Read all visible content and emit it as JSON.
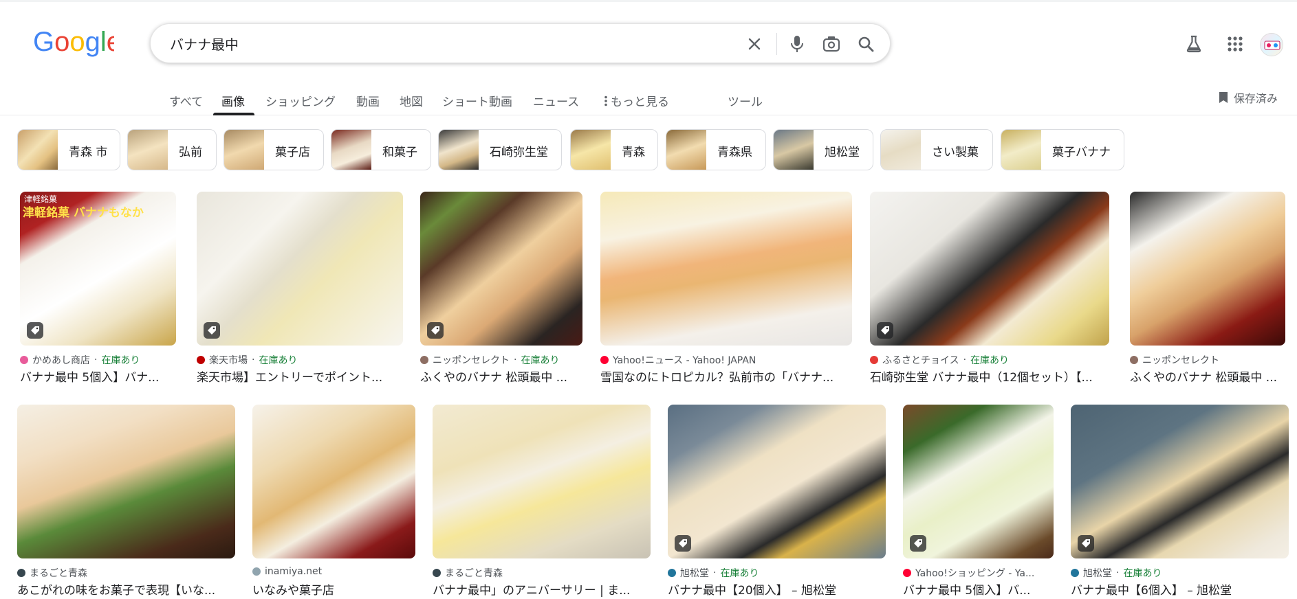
{
  "search": {
    "query": "バナナ最中"
  },
  "header": {
    "logo_text": "Google"
  },
  "tabs": [
    {
      "label": "すべて"
    },
    {
      "label": "画像"
    },
    {
      "label": "ショッピング"
    },
    {
      "label": "動画"
    },
    {
      "label": "地図"
    },
    {
      "label": "ショート動画"
    },
    {
      "label": "ニュース"
    },
    {
      "label": "もっと見る"
    },
    {
      "label": "ツール"
    }
  ],
  "active_tab": "画像",
  "saved_label": "保存済み",
  "chips": [
    {
      "label": "青森 市"
    },
    {
      "label": "弘前"
    },
    {
      "label": "菓子店"
    },
    {
      "label": "和菓子"
    },
    {
      "label": "石崎弥生堂"
    },
    {
      "label": "青森"
    },
    {
      "label": "青森県"
    },
    {
      "label": "旭松堂"
    },
    {
      "label": "さい製菓"
    },
    {
      "label": "菓子バナナ"
    }
  ],
  "results": [
    {
      "source": "かめあし商店",
      "stock": "在庫あり",
      "title": "バナナ最中 5個入】バナ...",
      "overlay": "津軽銘菓 バナナもなか"
    },
    {
      "source": "楽天市場",
      "stock": "在庫あり",
      "title": "楽天市場】エントリーでポイント..."
    },
    {
      "source": "ニッポンセレクト",
      "stock": "在庫あり",
      "title": "ふくやのバナナ 松頭最中 ..."
    },
    {
      "source": "Yahoo!ニュース - Yahoo! JAPAN",
      "stock": "",
      "title": "雪国なのにトロピカル？弘前市の「バナナ..."
    },
    {
      "source": "ふるさとチョイス",
      "stock": "在庫あり",
      "title": "石崎弥生堂 バナナ最中（12個セット）【..."
    },
    {
      "source": "ニッポンセレクト",
      "stock": "",
      "title": "ふくやのバナナ 松頭最中 ..."
    },
    {
      "source": "まるごと青森",
      "stock": "",
      "title": "あこがれの味をお菓子で表現【いな..."
    },
    {
      "source": "inamiya.net",
      "stock": "",
      "title": "いなみや菓子店"
    },
    {
      "source": "まるごと青森",
      "stock": "",
      "title": "バナナ最中」のアニバーサリー | ま..."
    },
    {
      "source": "旭松堂",
      "stock": "在庫あり",
      "title": "バナナ最中【20個入】 – 旭松堂"
    },
    {
      "source": "Yahoo!ショッピング - Ya...",
      "stock": "",
      "title": "バナナ最中 5個入】バ..."
    },
    {
      "source": "旭松堂",
      "stock": "在庫あり",
      "title": "バナナ最中【6個入】 – 旭松堂"
    }
  ],
  "colors": {
    "google_blue": "#4285F4",
    "google_red": "#EA4335",
    "google_yellow": "#FBBC05",
    "google_green": "#34A853",
    "stock_green": "#188038"
  },
  "icons": [
    "close-icon",
    "mic-icon",
    "lens-icon",
    "search-icon",
    "labs-flask-icon",
    "apps-grid-icon",
    "bookmark-icon",
    "tag-icon"
  ]
}
